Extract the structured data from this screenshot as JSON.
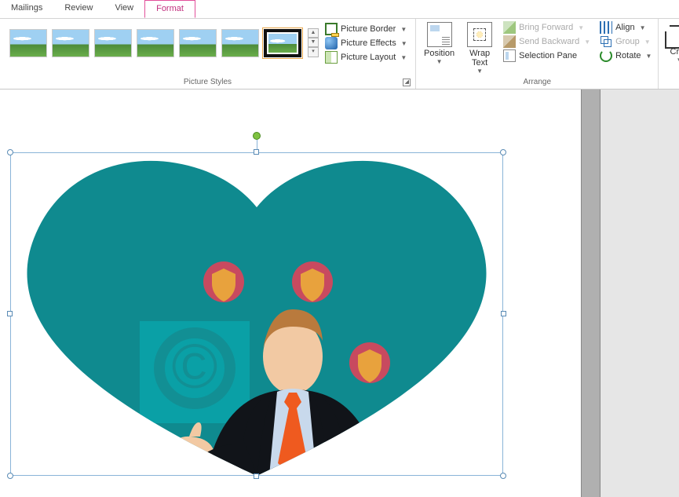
{
  "tabs": {
    "mailings": "Mailings",
    "review": "Review",
    "view": "View",
    "format": "Format"
  },
  "groups": {
    "picture_styles": "Picture Styles",
    "arrange": "Arrange"
  },
  "buttons": {
    "picture_border": "Picture Border",
    "picture_effects": "Picture Effects",
    "picture_layout": "Picture Layout",
    "position": "Position",
    "wrap_text": "Wrap Text",
    "bring_forward": "Bring Forward",
    "send_backward": "Send Backward",
    "selection_pane": "Selection Pane",
    "align": "Align",
    "group": "Group",
    "rotate": "Rotate",
    "crop": "Crop"
  },
  "canvas": {
    "shape": "heart",
    "fill_color": "#0f8a8f",
    "copyright_glyph": "©",
    "accent_shield": "#e8a23d",
    "accent_ring": "#c84a5f",
    "tie_color": "#ef5a1f",
    "suit_color": "#111419",
    "skin_color": "#f2c9a3",
    "hair_color": "#b97a3d",
    "shirt_color": "#c8d9ec"
  }
}
